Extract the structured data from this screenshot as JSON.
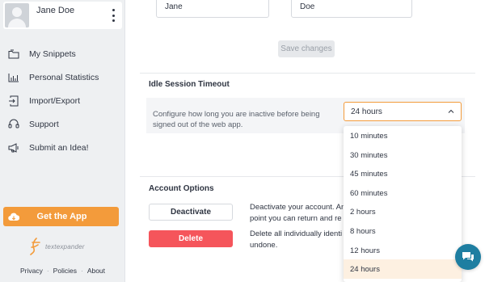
{
  "profile": {
    "name": "Jane Doe"
  },
  "sidebar": {
    "items": [
      {
        "label": "My Snippets",
        "icon": "folder-icon"
      },
      {
        "label": "Personal Statistics",
        "icon": "bar-chart-icon"
      },
      {
        "label": "Import/Export",
        "icon": "import-export-icon"
      },
      {
        "label": "Support",
        "icon": "headset-icon"
      },
      {
        "label": "Submit an Idea!",
        "icon": "megaphone-icon"
      }
    ],
    "get_app_label": "Get the App",
    "logo_text": "textexpander",
    "footer": {
      "privacy": "Privacy",
      "policies": "Policies",
      "about": "About"
    }
  },
  "main": {
    "first_name_value": "Jane",
    "last_name_value": "Doe",
    "save_label": "Save changes",
    "idle_title": "Idle Session Timeout",
    "idle_desc": "Configure how long you are inactive before being signed out of the web app.",
    "select_value": "24 hours",
    "options": [
      "10 minutes",
      "30 minutes",
      "45 minutes",
      "60 minutes",
      "2 hours",
      "8 hours",
      "12 hours",
      "24 hours"
    ],
    "account_title": "Account Options",
    "deactivate_label": "Deactivate",
    "deactivate_text_1": "Deactivate your account. An",
    "deactivate_text_2": "point you can return and re",
    "delete_label": "Delete",
    "delete_text_1": "Delete all individually identi",
    "delete_text_2": "undone."
  },
  "colors": {
    "accent": "#f39b3b",
    "danger": "#f5555b",
    "chat": "#1e7ea1",
    "selected_option_bg": "#fdf0e1"
  }
}
